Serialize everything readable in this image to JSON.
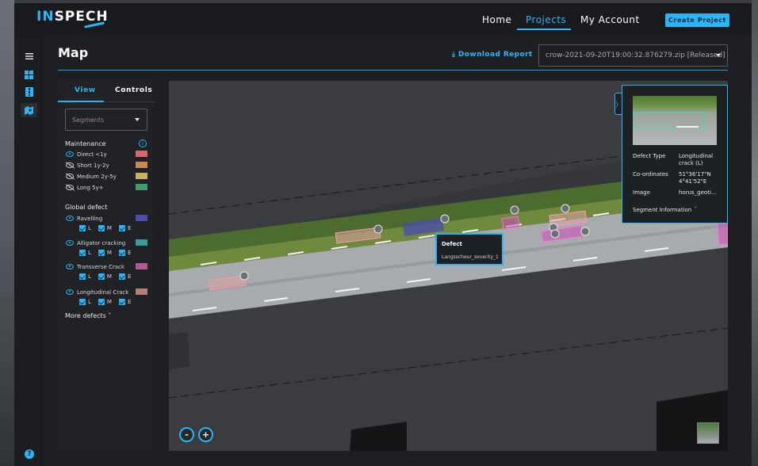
{
  "brand": {
    "name_part1": "IN",
    "name_part2": "SPECH"
  },
  "nav": {
    "home": "Home",
    "projects": "Projects",
    "account": "My Account",
    "create": "Create Project"
  },
  "header": {
    "title": "Map",
    "download": "Download Report",
    "file": "crow-2021-09-20T19:00:32.876279.zip [Released]"
  },
  "panel": {
    "tabs": {
      "view": "View",
      "controls": "Controls"
    },
    "segments_placeholder": "Segments",
    "maintenance": {
      "title": "Maintenance",
      "items": [
        {
          "label": "Direct <1y",
          "color": "#d36b6b",
          "visible": true
        },
        {
          "label": "Short 1y-2y",
          "color": "#c98a55",
          "visible": false
        },
        {
          "label": "Medium 2y-5y",
          "color": "#c7b060",
          "visible": false
        },
        {
          "label": "Long 5y+",
          "color": "#3f9d6e",
          "visible": false
        }
      ]
    },
    "global_defect": {
      "title": "Global defect",
      "items": [
        {
          "label": "Ravelling",
          "color": "#4b4da6"
        },
        {
          "label": "Alligator cracking",
          "color": "#3f9c94"
        },
        {
          "label": "Transverse Crack",
          "color": "#b05b8f"
        },
        {
          "label": "Longitudinal Crack",
          "color": "#b77c7c"
        }
      ],
      "severity": [
        "L",
        "M",
        "E"
      ]
    },
    "more": "More defects"
  },
  "map": {
    "tooltip": {
      "title": "Defect",
      "subtitle": "Langsscheur_severity_1"
    },
    "zoom_out": "-",
    "zoom_in": "+"
  },
  "info_card": {
    "defect_type_label": "Defect Type",
    "defect_type": "Longitudinal crack (L)",
    "coords_label": "Co-ordinates",
    "coords_1": "51°36'17\"N",
    "coords_2": "4°41'52\"E",
    "image_label": "Image",
    "image": "horus_geoti...",
    "segment_info": "Segment Information"
  }
}
